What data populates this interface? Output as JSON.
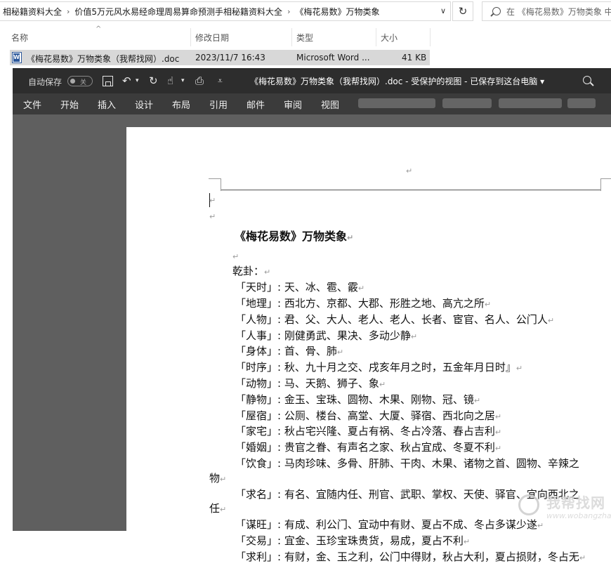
{
  "explorer": {
    "breadcrumb": [
      "相秘籍资料大全",
      "价值5万元风水易经命理周易算命预测手相秘籍资料大全",
      "《梅花易数》万物类象"
    ],
    "search_placeholder": "在 《梅花易数》万物类象 中",
    "columns": {
      "name": "名称",
      "modified": "修改日期",
      "type": "类型",
      "size": "大小"
    },
    "file": {
      "name": "《梅花易数》万物类象（我帮找网）.doc",
      "modified": "2023/11/7 16:43",
      "type": "Microsoft Word ...",
      "size": "41 KB",
      "icon": "word-doc-icon"
    }
  },
  "word": {
    "autosave_label": "自动保存",
    "autosave_state": "关",
    "doc_title": "《梅花易数》万物类象（我帮找网）.doc  -  受保护的视图  -  已保存到这台电脑 ▾",
    "ribbon_tabs": [
      "文件",
      "开始",
      "插入",
      "设计",
      "布局",
      "引用",
      "邮件",
      "审阅",
      "视图"
    ],
    "paragraph_mark": "↵"
  },
  "document": {
    "title": "《梅花易数》万物类象",
    "section": "乾卦：",
    "lines": [
      {
        "text": "「天时」: 天、冰、雹、霰",
        "indent": 1
      },
      {
        "text": "「地理」: 西北方、京都、大郡、形胜之地、高亢之所",
        "indent": 1
      },
      {
        "text": "「人物」: 君、父、大人、老人、老人、长者、宦官、名人、公门人",
        "indent": 1
      },
      {
        "text": "「人事」: 刚健勇武、果决、多动少静",
        "indent": 1
      },
      {
        "text": "「身体」: 首、骨、肺",
        "indent": 1
      },
      {
        "text": "「时序」: 秋、九十月之交、戌亥年月之时，五金年月日时』",
        "indent": 1
      },
      {
        "text": "「动物」: 马、天鹅、狮子、象",
        "indent": 1
      },
      {
        "text": "「静物」: 金玉、宝珠、圆物、木果、刚物、冠、镜",
        "indent": 1
      },
      {
        "text": "「屋宿」: 公厕、楼台、高堂、大厦、驿宿、西北向之居",
        "indent": 1
      },
      {
        "text": "「家宅」: 秋占宅兴隆、夏占有祸、冬占冷落、春占吉利",
        "indent": 1
      },
      {
        "text": "「婚姻」: 贵官之眷、有声名之家、秋占宜成、冬夏不利",
        "indent": 1
      },
      {
        "text": "「饮食」: 马肉珍味、多骨、肝肺、干肉、木果、诸物之首、圆物、辛辣之",
        "indent": 1
      },
      {
        "text": "物",
        "indent": 0
      },
      {
        "text": "「求名」: 有名、宜随内任、刑官、武职、掌权、天使、驿官、宜向西北之",
        "indent": 1
      },
      {
        "text": "任",
        "indent": 0
      },
      {
        "text": "「谋旺」: 有成、利公门、宜动中有财、夏占不成、冬占多谋少遂",
        "indent": 1
      },
      {
        "text": "「交易」: 宜金、玉珍宝珠贵货，易成，夏占不利",
        "indent": 1
      },
      {
        "text": "「求利」: 有财，金、玉之利，公门中得财，秋占大利，夏占损财，冬占无",
        "indent": 1
      }
    ]
  },
  "watermark": {
    "text": "我帮找网",
    "subtext": "www.wobangzhao.com"
  }
}
